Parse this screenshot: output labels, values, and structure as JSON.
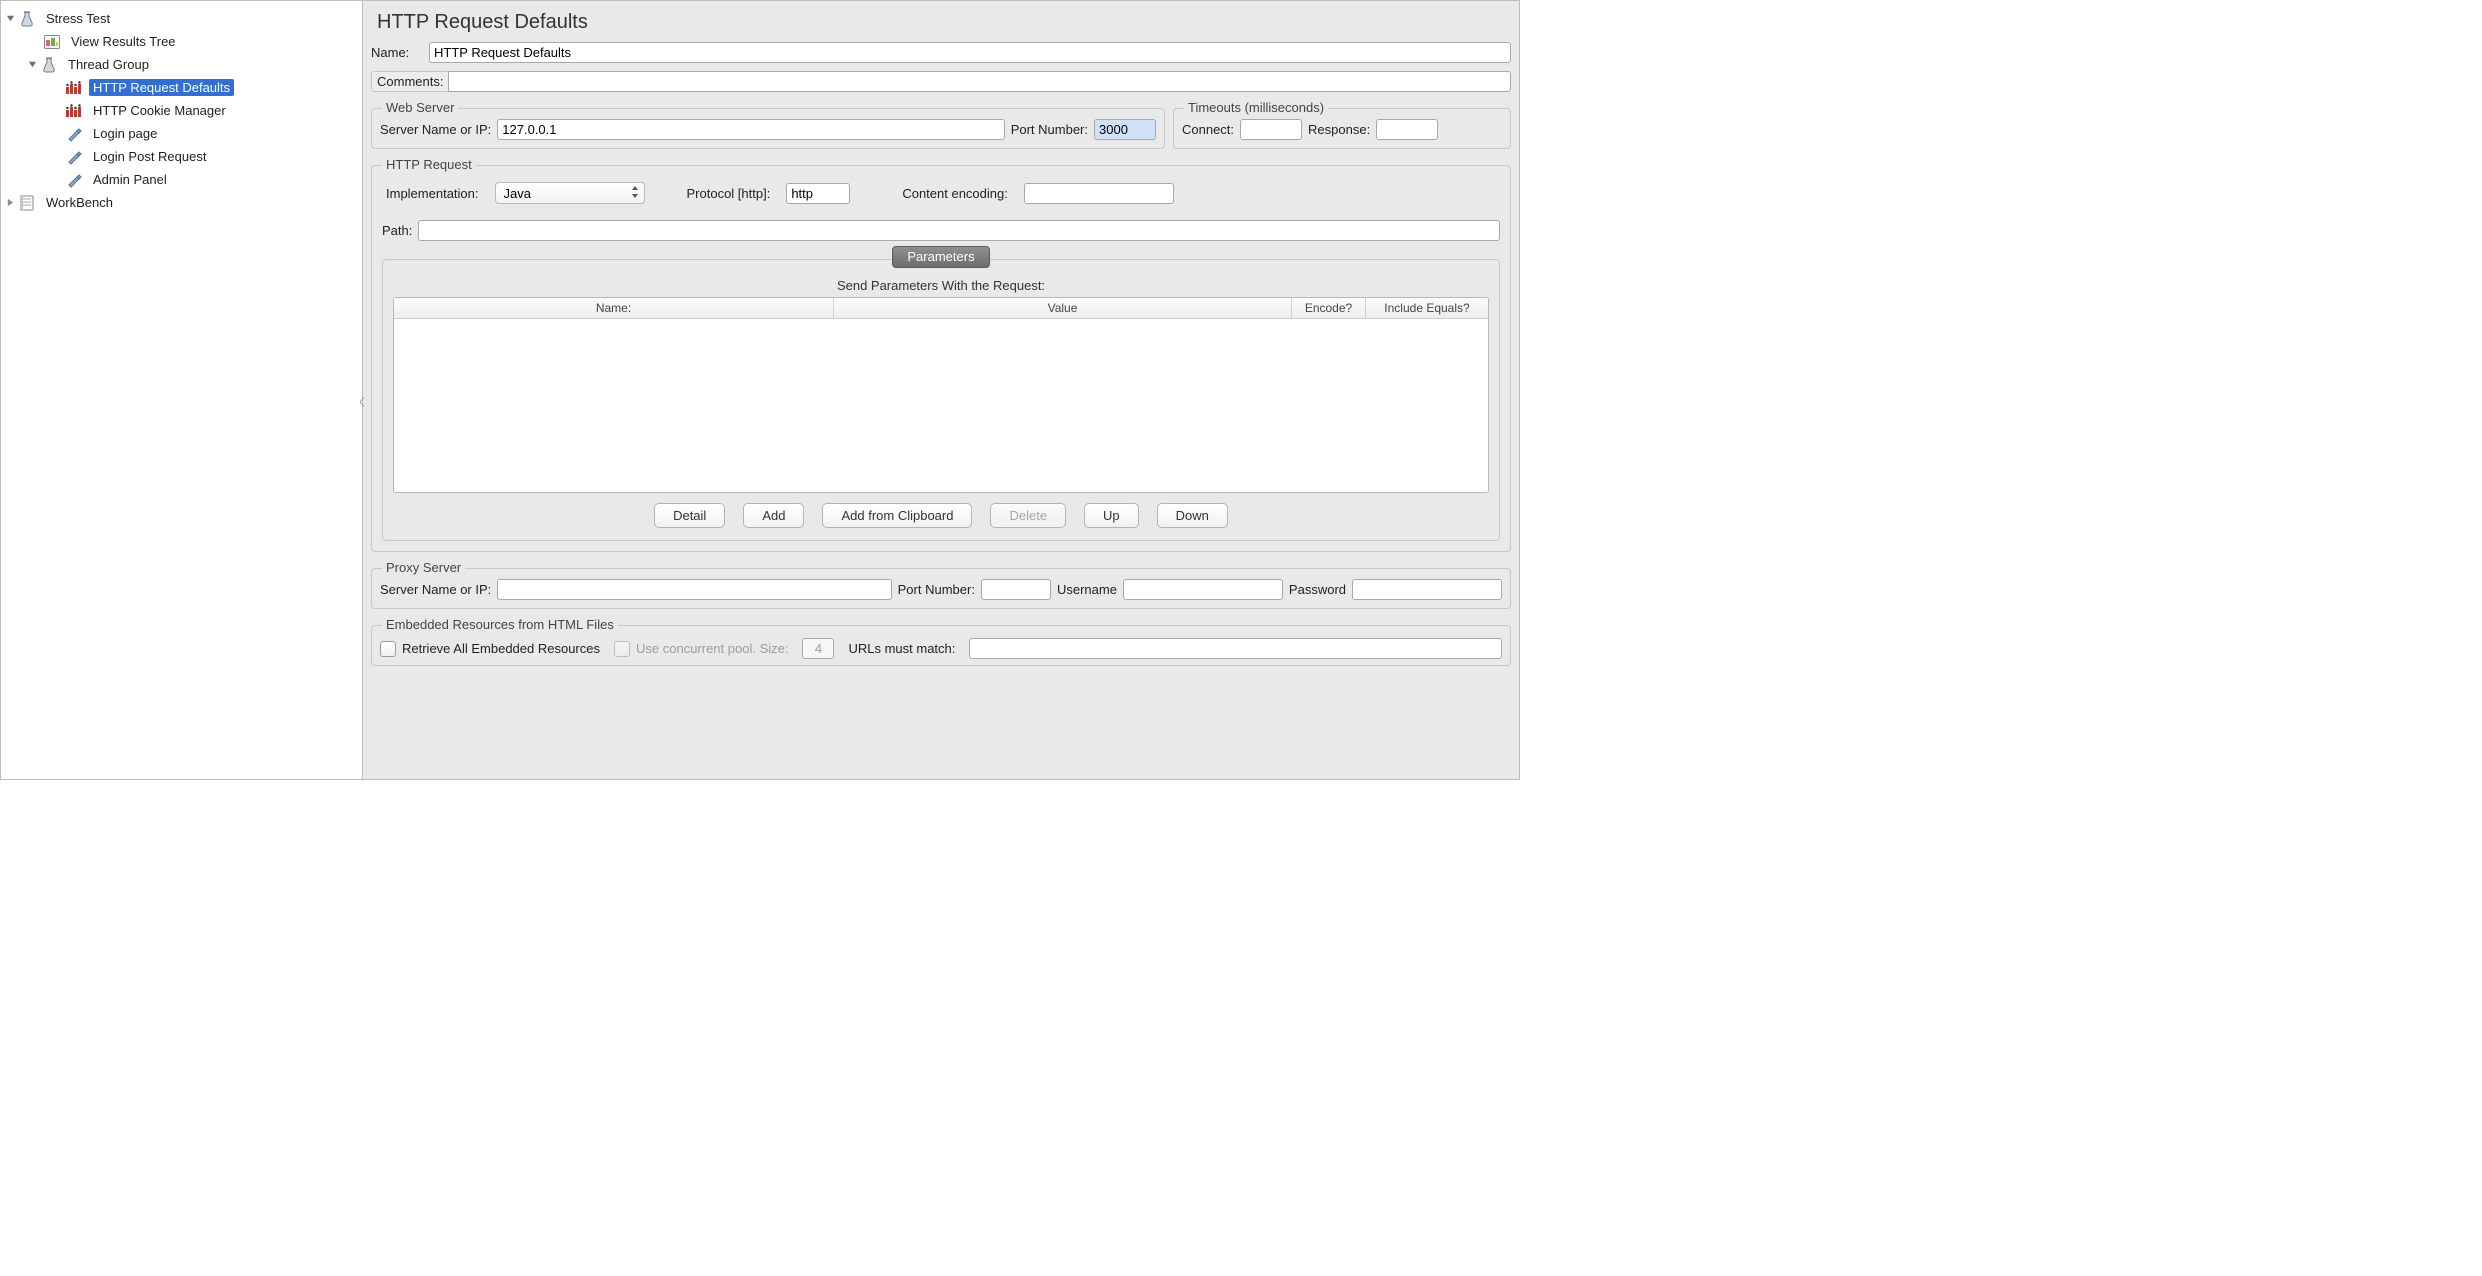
{
  "tree": {
    "root": {
      "label": "Stress Test"
    },
    "view_results": {
      "label": "View Results Tree"
    },
    "thread_group": {
      "label": "Thread Group"
    },
    "http_defaults": {
      "label": "HTTP Request Defaults"
    },
    "cookie_mgr": {
      "label": "HTTP Cookie Manager"
    },
    "login_page": {
      "label": "Login page"
    },
    "login_post": {
      "label": "Login Post Request"
    },
    "admin_panel": {
      "label": "Admin Panel"
    },
    "workbench": {
      "label": "WorkBench"
    }
  },
  "page": {
    "title": "HTTP Request Defaults",
    "name_label": "Name:",
    "name_value": "HTTP Request Defaults",
    "comments_label": "Comments:",
    "comments_value": ""
  },
  "webserver": {
    "legend": "Web Server",
    "server_label": "Server Name or IP:",
    "server_value": "127.0.0.1",
    "port_label": "Port Number:",
    "port_value": "3000"
  },
  "timeouts": {
    "legend": "Timeouts (milliseconds)",
    "connect_label": "Connect:",
    "connect_value": "",
    "response_label": "Response:",
    "response_value": ""
  },
  "httpreq": {
    "legend": "HTTP Request",
    "impl_label": "Implementation:",
    "impl_value": "Java",
    "proto_label": "Protocol [http]:",
    "proto_value": "http",
    "enc_label": "Content encoding:",
    "enc_value": "",
    "path_label": "Path:",
    "path_value": ""
  },
  "params": {
    "tab_label": "Parameters",
    "title": "Send Parameters With the Request:",
    "cols": {
      "name": "Name:",
      "value": "Value",
      "encode": "Encode?",
      "include": "Include Equals?"
    },
    "buttons": {
      "detail": "Detail",
      "add": "Add",
      "add_clip": "Add from Clipboard",
      "delete": "Delete",
      "up": "Up",
      "down": "Down"
    }
  },
  "proxy": {
    "legend": "Proxy Server",
    "server_label": "Server Name or IP:",
    "server_value": "",
    "port_label": "Port Number:",
    "port_value": "",
    "user_label": "Username",
    "user_value": "",
    "pass_label": "Password",
    "pass_value": ""
  },
  "embedded": {
    "legend": "Embedded Resources from HTML Files",
    "retrieve_label": "Retrieve All Embedded Resources",
    "pool_label": "Use concurrent pool. Size:",
    "pool_value": "4",
    "urls_label": "URLs must match:",
    "urls_value": ""
  }
}
